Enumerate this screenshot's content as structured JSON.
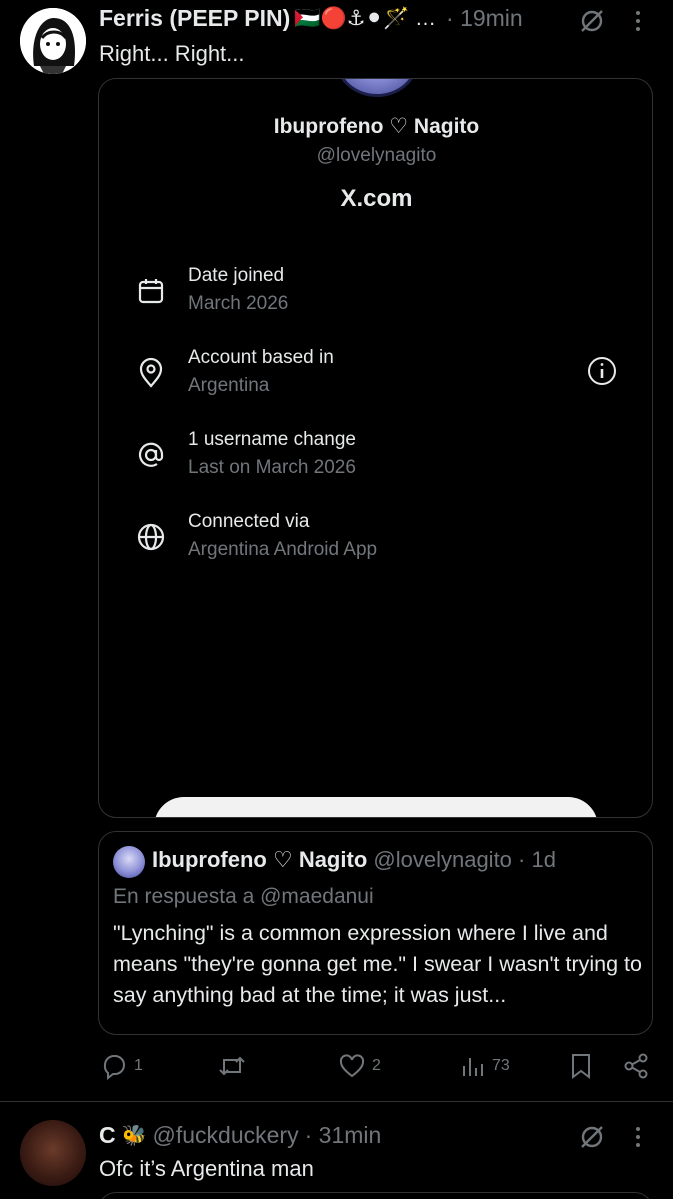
{
  "tweet1": {
    "name": "Ferris (PEEP PIN)",
    "emojis": "🇵🇸🔴⚓⚫🪄 …",
    "time": "· 19min",
    "text": "Right... Right..."
  },
  "about_card": {
    "name": "Ibuprofeno ♡ Nagito",
    "handle": "@lovelynagito",
    "site": "X.com",
    "rows": [
      {
        "icon": "calendar-icon",
        "title": "Date joined",
        "sub": "March 2026"
      },
      {
        "icon": "location-pin-icon",
        "title": "Account based in",
        "sub": "Argentina"
      },
      {
        "icon": "at-sign-icon",
        "title": "1 username change",
        "sub": "Last on March 2026"
      },
      {
        "icon": "globe-icon",
        "title": "Connected via",
        "sub": "Argentina Android App"
      }
    ]
  },
  "quote": {
    "name": "Ibuprofeno ♡ Nagito",
    "handle": "@lovelynagito",
    "time": "· 1d",
    "reply_to": "En respuesta a @maedanui",
    "text": "\"Lynching\" is a common expression where I live and means \"they're gonna get me.\" I swear I wasn't trying to say anything bad at the time; it was just..."
  },
  "actions": {
    "replies": "1",
    "reposts": "",
    "likes": "2",
    "views": "73"
  },
  "tweet2": {
    "name": "C",
    "emoji": "🐝",
    "handle": "@fuckduckery",
    "time": "· 31min",
    "text": "Ofc it’s Argentina man"
  },
  "colors": {
    "background": "#000000",
    "text": "#e7e9ea",
    "muted": "#71767b",
    "border": "#2f3336"
  }
}
